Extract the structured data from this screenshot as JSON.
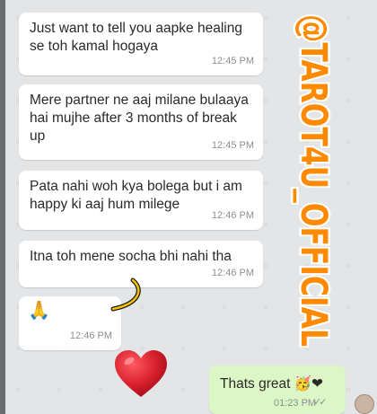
{
  "messages": [
    {
      "text": "Just want to tell you aapke healing se toh kamal hogaya",
      "time": "12:45 PM"
    },
    {
      "text": "Mere partner ne aaj milane bulaaya hai mujhe after 3 months of break up",
      "time": "12:45 PM"
    },
    {
      "text": "Pata nahi woh kya bolega but i am happy ki aaj hum milege",
      "time": "12:46 PM"
    },
    {
      "text": "Itna toh mene socha bhi nahi tha",
      "time": "12:46 PM"
    },
    {
      "emoji": "🙏",
      "time": "12:46 PM"
    }
  ],
  "reply": {
    "text": "Thats great 🥳❤",
    "time": "01:23 PM",
    "ticks": "✓✓"
  },
  "watermark": {
    "text": "@TAROT4U_OFFICIAL",
    "color": "#ff8a00"
  },
  "colors": {
    "incoming": "#ffffff",
    "outgoing": "#dcf7c5",
    "heart": "#d71f2b"
  }
}
